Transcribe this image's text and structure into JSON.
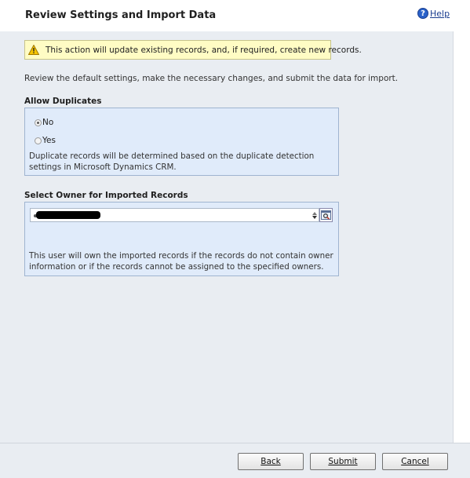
{
  "header": {
    "title": "Review Settings and Import Data",
    "help_label": "Help"
  },
  "warning": {
    "text": "This action will update existing records, and, if required, create new records."
  },
  "instructions": "Review the default settings, make the necessary changes, and submit the data for import.",
  "allow_duplicates": {
    "label": "Allow Duplicates",
    "options": [
      {
        "label": "No",
        "selected": true
      },
      {
        "label": "Yes",
        "selected": false
      }
    ],
    "note": "Duplicate records will be determined based on the duplicate detection settings in Microsoft Dynamics CRM."
  },
  "owner": {
    "label": "Select Owner for Imported Records",
    "value": "",
    "note": "This user will own the imported records if the records do not contain owner information or if the records cannot be assigned to the specified owners."
  },
  "footer": {
    "back_label": "Back",
    "submit_label": "Submit",
    "cancel_label": "Cancel"
  },
  "colors": {
    "warning_bg": "#fffcc4",
    "panel_bg": "#e0ebfa",
    "content_bg": "#e9edf2",
    "link": "#1a3d8f"
  }
}
